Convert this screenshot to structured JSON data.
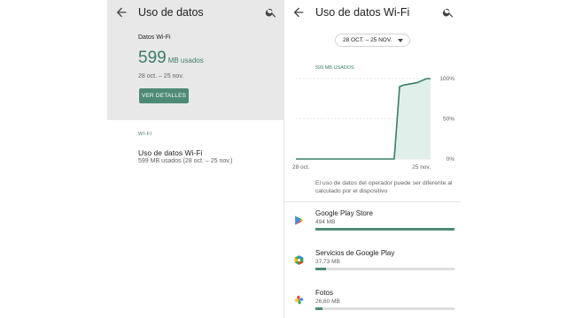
{
  "left": {
    "title": "Uso de datos",
    "summary_label": "Datos Wi-Fi",
    "usage_value": "599",
    "usage_unit": "MB usados",
    "date_range": "28 oct. – 25 nov.",
    "details_button": "VER DETALLES",
    "section_header": "WI-FI",
    "pref_title": "Uso de datos Wi-Fi",
    "pref_summary": "599 MB usados (28 oct. – 25 nov.)"
  },
  "right": {
    "title": "Uso de datos Wi-Fi",
    "cycle_selector": "28 OCT. – 25 NOV.",
    "disclaimer": "El uso de datos del operador puede ser diferente al calculado por el dispositivo",
    "apps": [
      {
        "name": "Google Play Store",
        "usage": "494 MB",
        "fraction": 1.0,
        "icon": "google-play-store-icon"
      },
      {
        "name": "Servicios de Google Play",
        "usage": "37,73 MB",
        "fraction": 0.076,
        "icon": "google-play-services-icon"
      },
      {
        "name": "Fotos",
        "usage": "26,60 MB",
        "fraction": 0.054,
        "icon": "google-photos-icon"
      }
    ]
  },
  "chart_data": {
    "type": "area",
    "title": "599 MB USADOS",
    "x_labels": [
      "28 oct.",
      "25 nov."
    ],
    "y_ticks": [
      "100%",
      "50%",
      "0%"
    ],
    "ylim": [
      0,
      100
    ],
    "x": [
      0,
      0.73,
      0.77,
      0.8,
      0.9,
      0.97,
      1.0
    ],
    "values": [
      0,
      0,
      90,
      92,
      95,
      100,
      100
    ],
    "color": "#3a7d6a"
  },
  "colors": {
    "accent": "#3a7d6a",
    "button": "#4d8a76",
    "summary_bg": "#e8e8e8"
  }
}
